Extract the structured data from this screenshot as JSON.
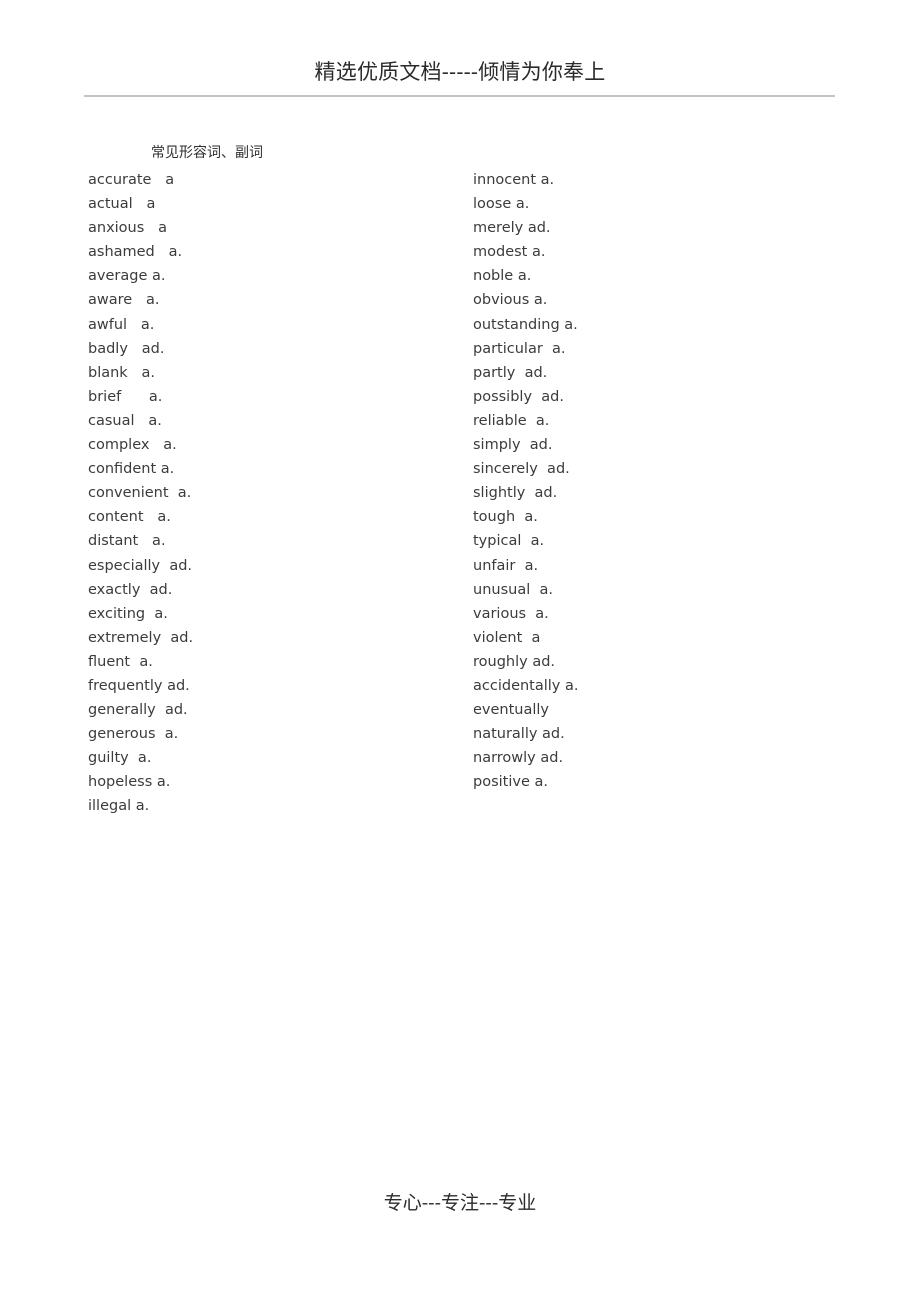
{
  "header": {
    "title": "精选优质文档-----倾情为你奉上",
    "rule": "horizontal-rule"
  },
  "section": {
    "title": "常见形容词、副词"
  },
  "footer": {
    "text": "专心---专注---专业"
  },
  "colors": {
    "text": "#3c3c3c",
    "heading": "#2b2b2b",
    "rule": "#c4c4c4",
    "background": "#ffffff"
  },
  "word_list": {
    "left_column": [
      "accurate   a",
      "actual   a",
      "anxious   a",
      "ashamed   a.",
      "average a.",
      "aware   a.",
      "awful   a.",
      "badly   ad.",
      "blank   a.",
      "brief      a.",
      "casual   a.",
      "complex   a.",
      "confident a.",
      "convenient  a.",
      "content   a.",
      "distant   a.",
      "especially  ad.",
      "exactly  ad.",
      "exciting  a.",
      "extremely  ad.",
      "fluent  a.",
      "frequently ad.",
      "generally  ad.",
      "generous  a.",
      "guilty  a.",
      "hopeless a.",
      "illegal a."
    ],
    "right_column": [
      "innocent a.",
      "loose a.",
      "merely ad.",
      "modest a.",
      "noble a.",
      "obvious a.",
      "outstanding a.",
      "particular  a.",
      "partly  ad.",
      "possibly  ad.",
      "reliable  a.",
      "simply  ad.",
      "sincerely  ad.",
      "slightly  ad.",
      "tough  a.",
      "typical  a.",
      "unfair  a.",
      "unusual  a.",
      "various  a.",
      "violent  a",
      "roughly ad.",
      "accidentally a.",
      "eventually",
      "naturally ad.",
      "narrowly ad.",
      "positive a."
    ]
  }
}
